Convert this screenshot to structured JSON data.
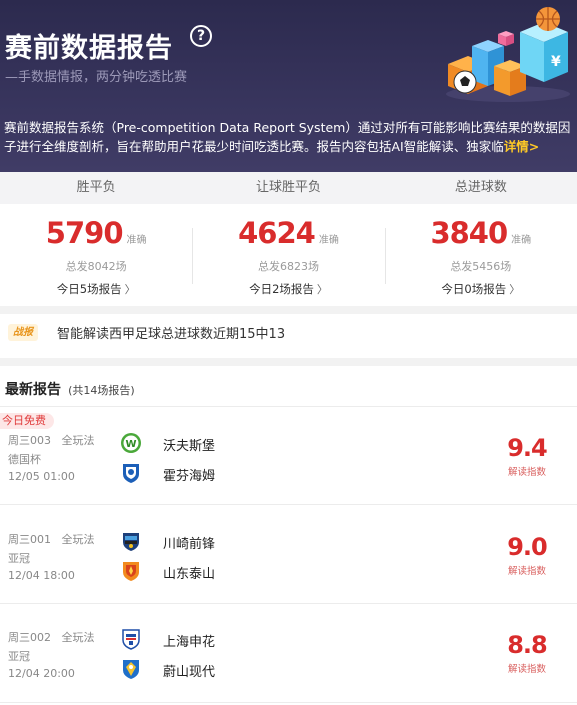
{
  "header": {
    "title": "赛前数据报告",
    "subtitle": "—手数据情报，两分钟吃透比赛",
    "description": "赛前数据报告系统（Pre-competition Data Report System）通过对所有可能影响比赛结果的数据因子进行全维度剖析，旨在帮助用户花最少时间吃透比赛。报告内容包括AI智能解读、独家临",
    "more_label": "详情>"
  },
  "stats": [
    {
      "label": "胜平负",
      "value": "5790",
      "unit": "准确",
      "total": "总发8042场",
      "today": "今日5场报告"
    },
    {
      "label": "让球胜平负",
      "value": "4624",
      "unit": "准确",
      "total": "总发6823场",
      "today": "今日2场报告"
    },
    {
      "label": "总进球数",
      "value": "3840",
      "unit": "准确",
      "total": "总发5456场",
      "today": "今日0场报告"
    }
  ],
  "notice": {
    "tag": "战报",
    "text": "智能解读西甲足球总进球数近期15中13"
  },
  "latest": {
    "title": "最新报告",
    "count": "(共14场报告)",
    "matches": [
      {
        "badge": "今日免费",
        "code": "周三003",
        "play": "全玩法",
        "league": "德国杯",
        "time": "12/05 01:00",
        "home": "沃夫斯堡",
        "away": "霍芬海姆",
        "score": "9.4",
        "score_label": "解读指数"
      },
      {
        "badge": "",
        "code": "周三001",
        "play": "全玩法",
        "league": "亚冠",
        "time": "12/04 18:00",
        "home": "川崎前锋",
        "away": "山东泰山",
        "score": "9.0",
        "score_label": "解读指数"
      },
      {
        "badge": "",
        "code": "周三002",
        "play": "全玩法",
        "league": "亚冠",
        "time": "12/04 20:00",
        "home": "上海申花",
        "away": "蔚山现代",
        "score": "8.8",
        "score_label": "解读指数"
      }
    ]
  },
  "colors": {
    "accent_red": "#d92c2c",
    "header_bg": "#2c2a4e",
    "link_yellow": "#ffc926"
  }
}
